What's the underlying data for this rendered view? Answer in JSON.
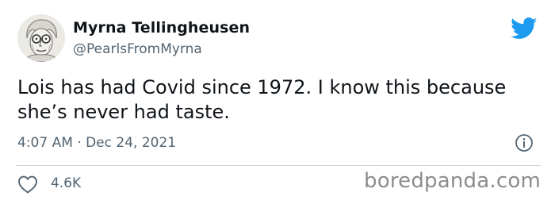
{
  "author": {
    "display_name": "Myrna Tellingheusen",
    "handle": "@PearlsFromMyrna"
  },
  "tweet": {
    "text": "Lois has had Covid since 1972. I know this because\nshe’s never had taste.",
    "timestamp": "4:07 AM · Dec 24, 2021"
  },
  "engagement": {
    "likes": "4.6K"
  },
  "watermark": {
    "text": "boredpanda.com"
  },
  "icons": {
    "bird": "twitter-bird-icon",
    "info": "info-icon",
    "like": "heart-icon"
  },
  "colors": {
    "brand_blue": "#1d9bf0",
    "secondary_text": "#536471",
    "divider": "#cfd9de",
    "watermark": "#8c8c8c"
  }
}
